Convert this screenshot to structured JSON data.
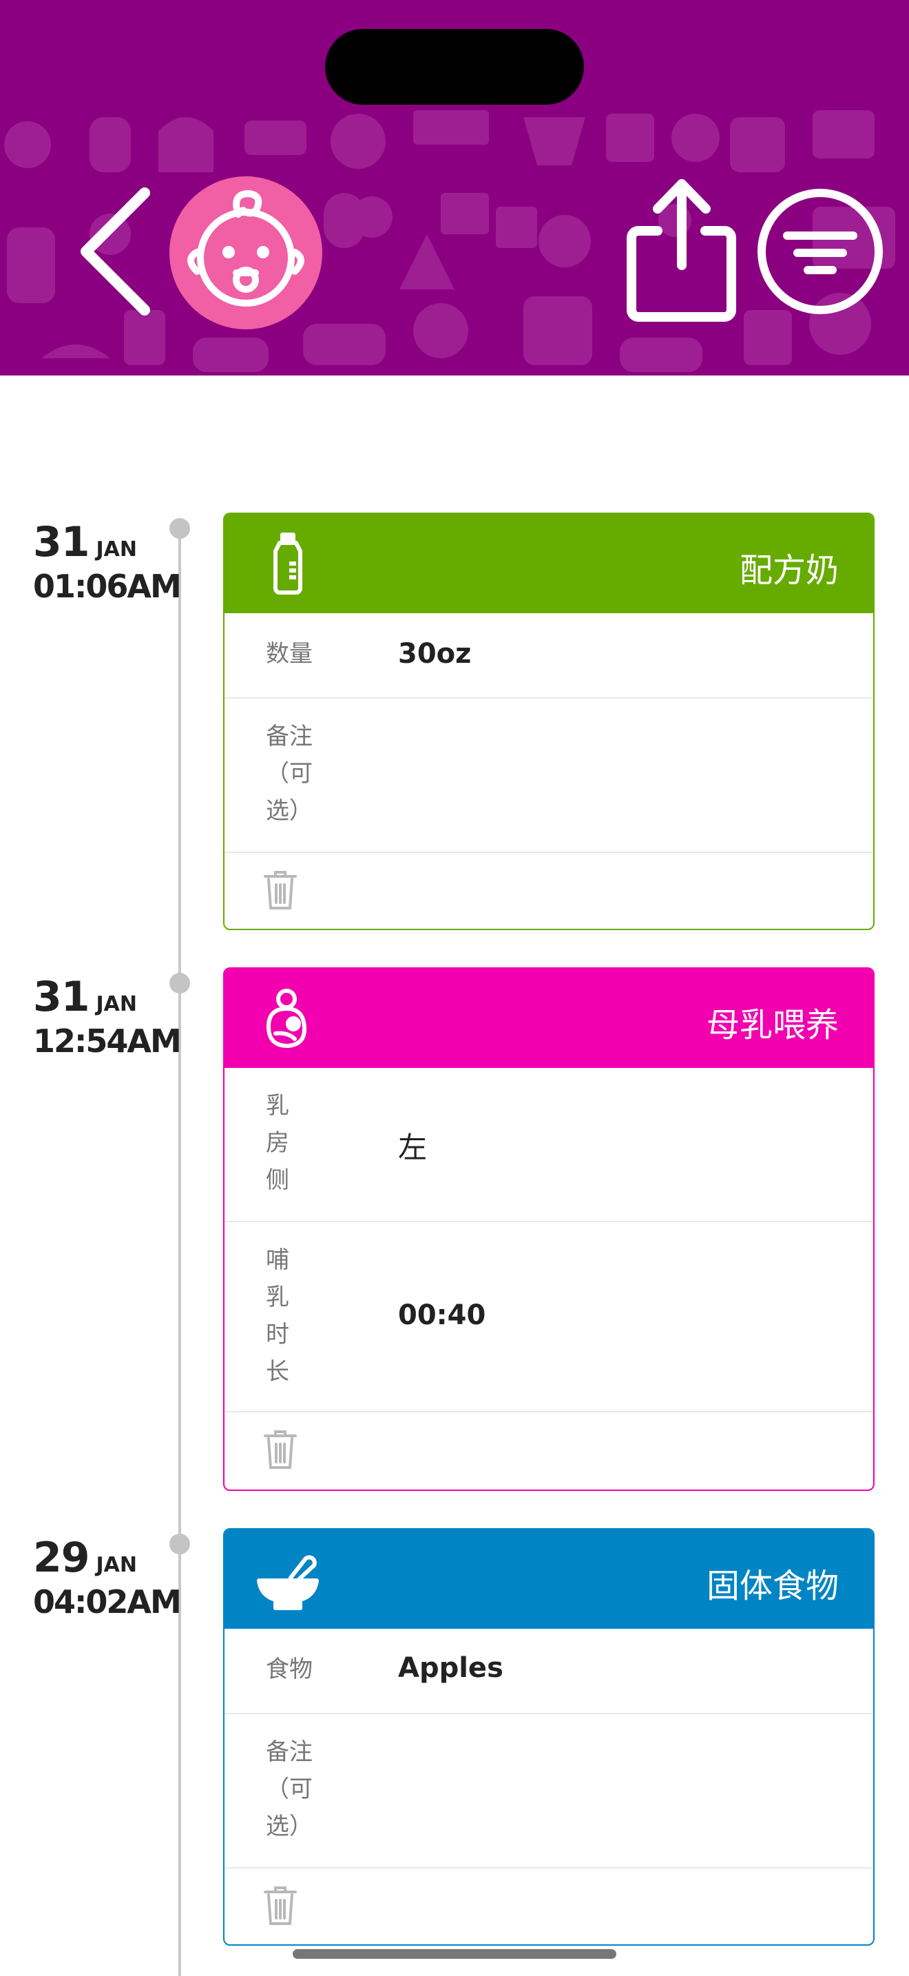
{
  "header": {
    "background_color": "#8b0080",
    "back_icon": "chevron-left-icon",
    "avatar_icon": "baby-face-icon",
    "avatar_color": "#f15fa5",
    "share_icon": "share-icon",
    "filter_icon": "filter-icon"
  },
  "entries": [
    {
      "day": "31",
      "month": "JAN",
      "time": "01:06AM",
      "type": "配方奶",
      "color": "#66ab00",
      "icon": "baby-bottle-icon",
      "rows": [
        {
          "label": "数量",
          "value": "30oz"
        },
        {
          "label": "备注（可选）",
          "value": ""
        }
      ]
    },
    {
      "day": "31",
      "month": "JAN",
      "time": "12:54AM",
      "type": "母乳喂养",
      "color": "#f200b0",
      "icon": "breastfeeding-icon",
      "rows": [
        {
          "label": "乳房侧",
          "value": "左"
        },
        {
          "label": "哺乳时长",
          "value": "00:40"
        }
      ]
    },
    {
      "day": "29",
      "month": "JAN",
      "time": "04:02AM",
      "type": "固体食物",
      "color": "#0184c4",
      "icon": "mortar-bowl-icon",
      "rows": [
        {
          "label": "食物",
          "value": "Apples"
        },
        {
          "label": "备注（可选）",
          "value": ""
        }
      ]
    }
  ],
  "trash_icon": "trash-icon"
}
